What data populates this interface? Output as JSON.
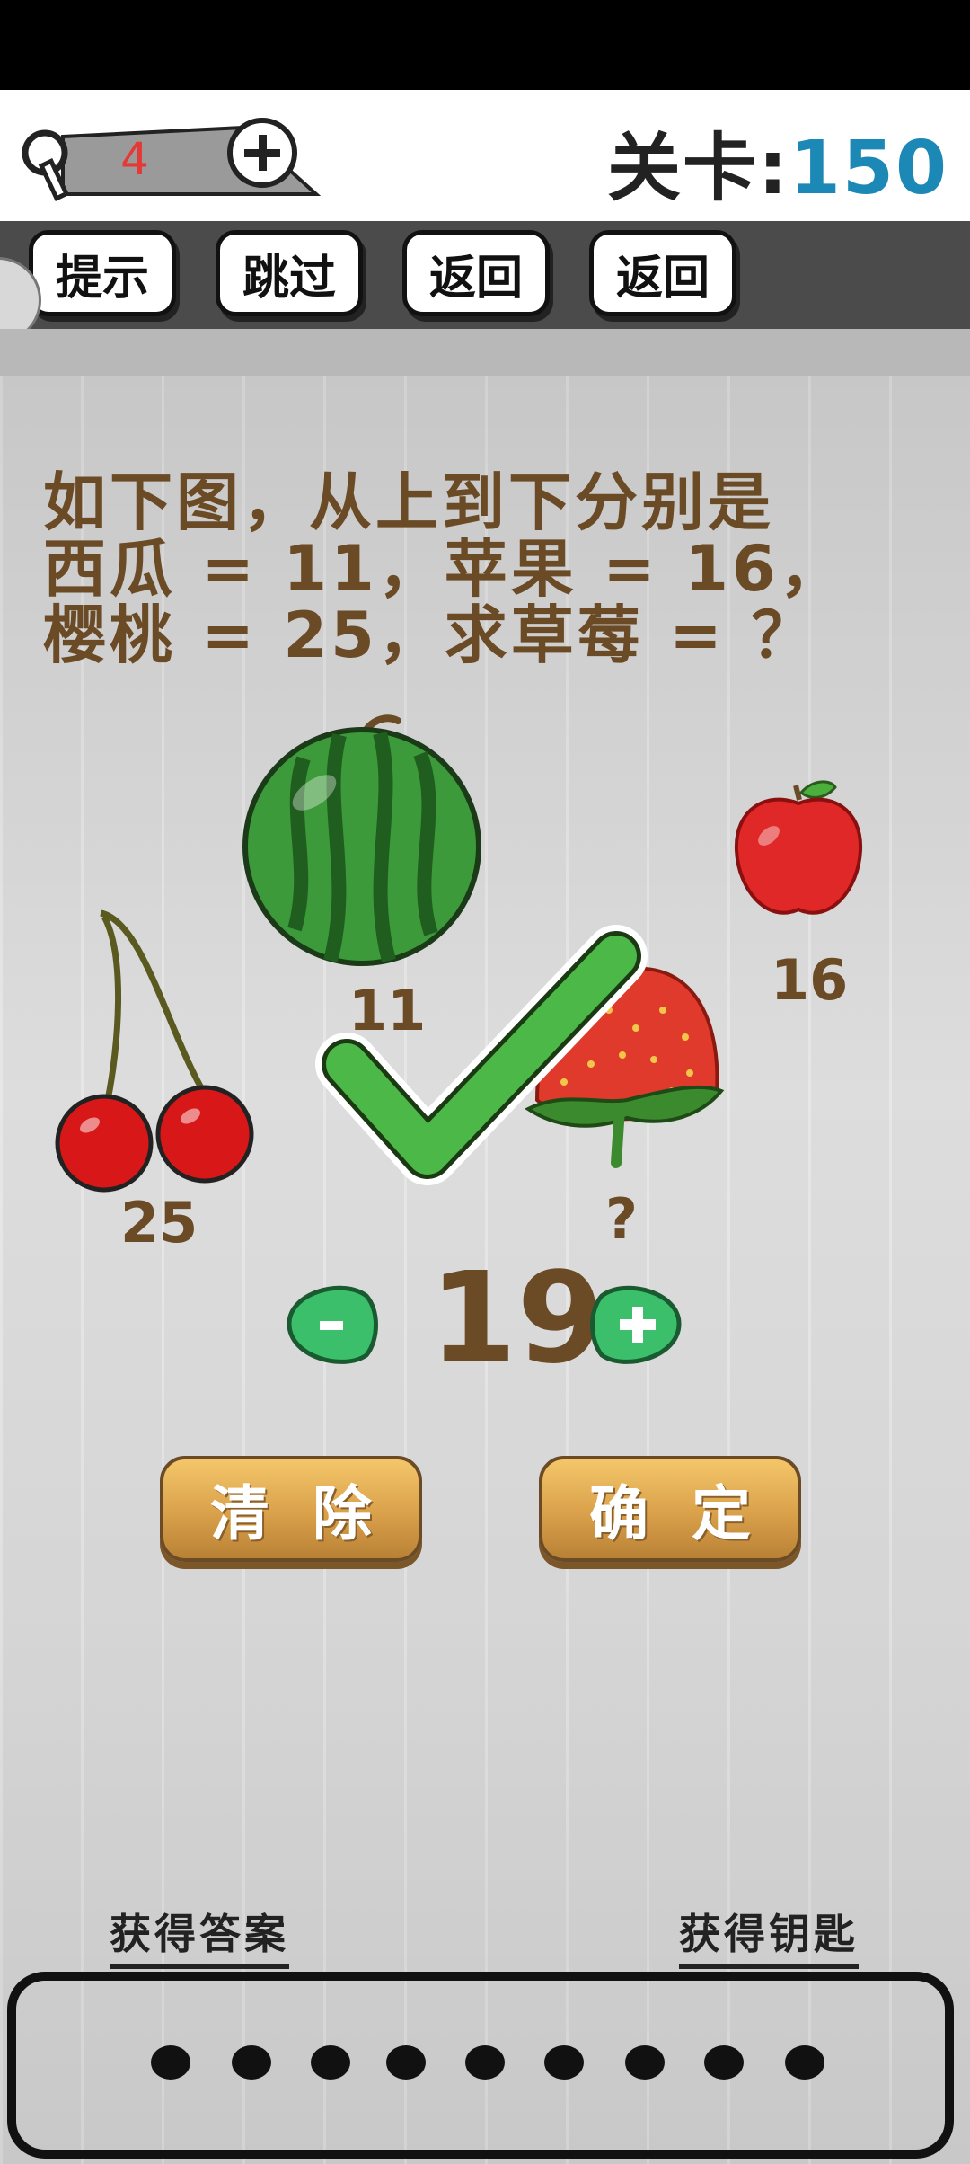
{
  "header": {
    "keys": "4",
    "level_prefix": "关卡:",
    "level_number": "150"
  },
  "toolbar": {
    "hint": "提示",
    "skip": "跳过",
    "back1": "返回",
    "back2": "返回"
  },
  "puzzle": {
    "line1": "如下图，从上到下分别是",
    "line2": "西瓜 = 11，苹果 = 16，",
    "line3": "樱桃 = 25，求草莓 = ？",
    "watermelon_value": "11",
    "apple_value": "16",
    "cherry_value": "25",
    "strawberry_value": "?"
  },
  "answer": {
    "value": "19",
    "minus": "-",
    "plus": "+"
  },
  "actions": {
    "clear": "清除",
    "confirm": "确定"
  },
  "links": {
    "get_answer": "获得答案",
    "get_key": "获得钥匙"
  },
  "answer_dots_count_label": "●●●●●●●●●",
  "colors": {
    "brown_text": "#6b4a26",
    "level_blue": "#1b88b5",
    "check_green": "#4cb848"
  }
}
